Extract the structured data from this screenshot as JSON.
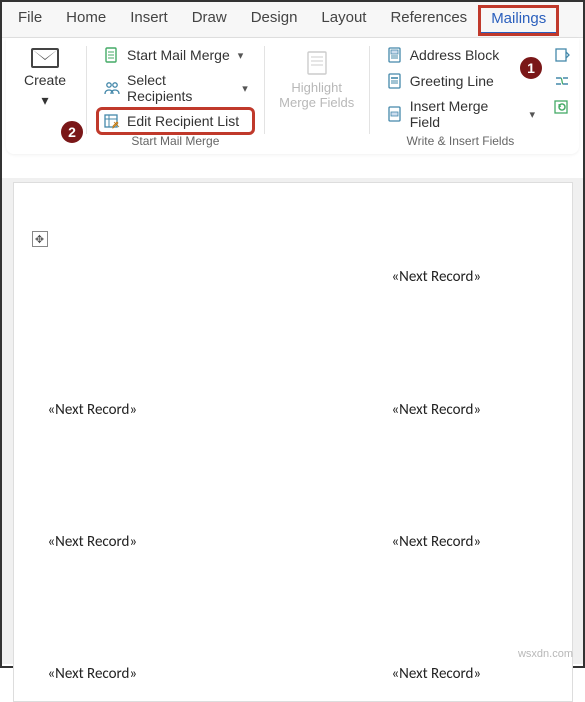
{
  "tabs": {
    "file": "File",
    "home": "Home",
    "insert": "Insert",
    "draw": "Draw",
    "design": "Design",
    "layout": "Layout",
    "references": "References",
    "mailings": "Mailings"
  },
  "ribbon": {
    "create_label": "Create",
    "start_group": {
      "start_merge": "Start Mail Merge",
      "select_recipients": "Select Recipients",
      "edit_recipients": "Edit Recipient List",
      "group_label": "Start Mail Merge"
    },
    "highlight": {
      "line1": "Highlight",
      "line2": "Merge Fields"
    },
    "write_group": {
      "address_block": "Address Block",
      "greeting_line": "Greeting Line",
      "insert_field": "Insert Merge Field",
      "group_label": "Write & Insert Fields"
    }
  },
  "annotations": {
    "badge1": "1",
    "badge2": "2"
  },
  "doc": {
    "field": "«Next Record»"
  },
  "watermark": "wsxdn.com"
}
